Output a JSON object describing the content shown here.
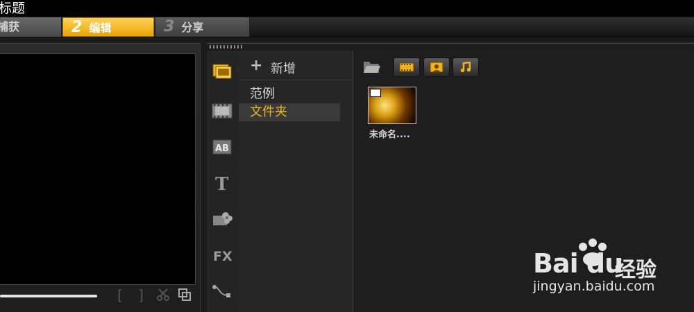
{
  "window": {
    "title": "标题"
  },
  "steps": [
    {
      "num": "",
      "label": "捕获"
    },
    {
      "num": "2",
      "label": "编辑"
    },
    {
      "num": "3",
      "label": "分享"
    }
  ],
  "library": {
    "add_label": "新增",
    "folders": [
      {
        "label": "范例",
        "selected": false
      },
      {
        "label": "文件夹",
        "selected": true
      }
    ],
    "tabs": [
      "media",
      "transition",
      "title-overlay",
      "text",
      "decoration",
      "filter",
      "path"
    ],
    "active_tab": "media",
    "items": [
      {
        "caption": "未命名...."
      }
    ]
  },
  "watermark": {
    "logo": "Bai du",
    "brand_cn": "经验",
    "url": "jingyan.baidu.com"
  },
  "colors": {
    "accent": "#f4b821",
    "step_active": "#f2b617",
    "background": "#1b1b1b"
  }
}
